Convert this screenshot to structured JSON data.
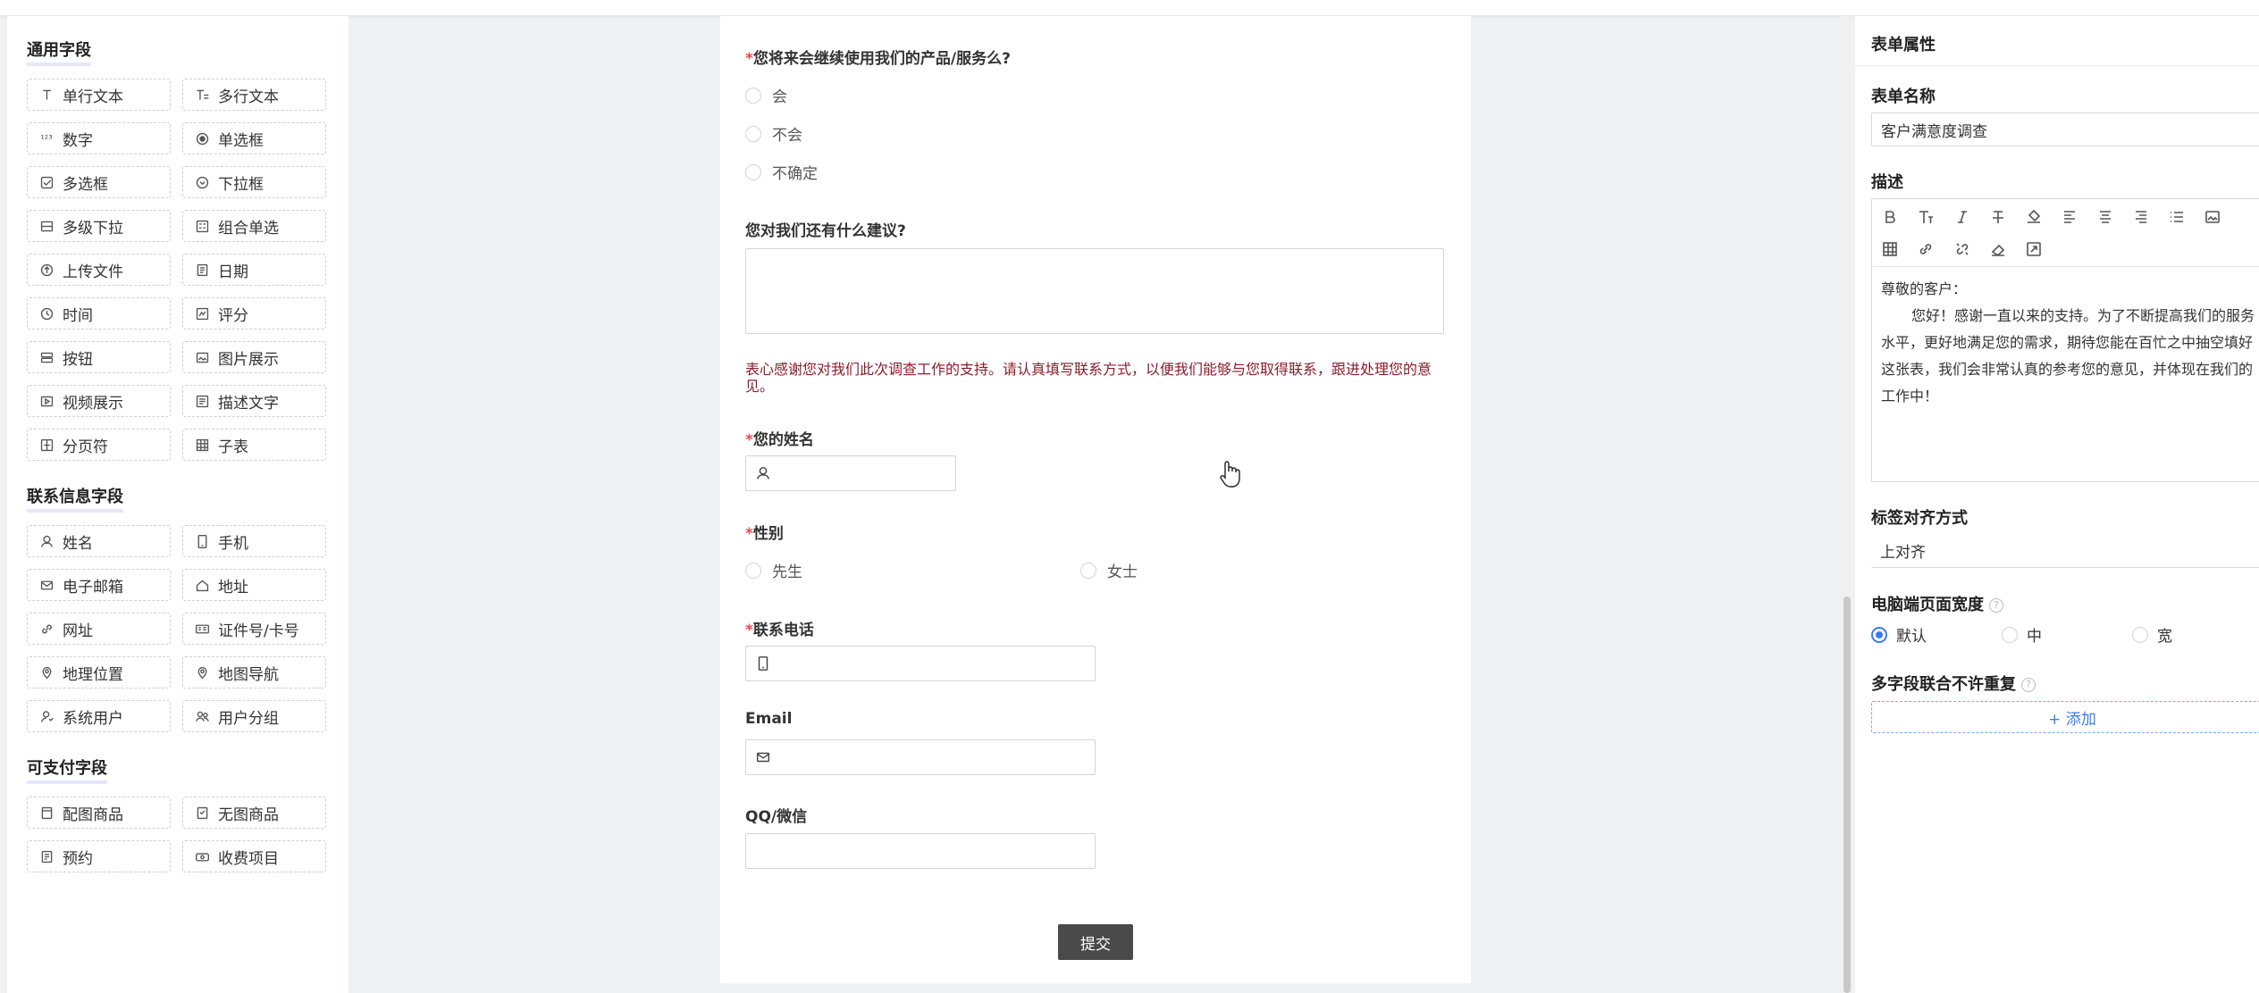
{
  "palette": {
    "sections": [
      {
        "title": "通用字段",
        "fields": [
          "单行文本",
          "多行文本",
          "数字",
          "单选框",
          "多选框",
          "下拉框",
          "多级下拉",
          "组合单选",
          "上传文件",
          "日期",
          "时间",
          "评分",
          "按钮",
          "图片展示",
          "视频展示",
          "描述文字",
          "分页符",
          "子表"
        ],
        "icons": [
          "text-icon",
          "multiline-text-icon",
          "number-icon",
          "radio-icon",
          "checkbox-icon",
          "dropdown-icon",
          "cascade-dropdown-icon",
          "combo-radio-icon",
          "upload-icon",
          "calendar-icon",
          "clock-icon",
          "rating-icon",
          "button-icon",
          "image-icon",
          "video-icon",
          "description-icon",
          "page-break-icon",
          "sub-table-icon"
        ]
      },
      {
        "title": "联系信息字段",
        "fields": [
          "姓名",
          "手机",
          "电子邮箱",
          "地址",
          "网址",
          "证件号/卡号",
          "地理位置",
          "地图导航",
          "系统用户",
          "用户分组"
        ],
        "icons": [
          "user-icon",
          "phone-icon",
          "mail-icon",
          "home-icon",
          "link-icon",
          "id-card-icon",
          "location-icon",
          "map-pin-icon",
          "system-user-icon",
          "user-group-icon"
        ]
      },
      {
        "title": "可支付字段",
        "fields": [
          "配图商品",
          "无图商品",
          "预约",
          "收费项目"
        ],
        "icons": [
          "product-image-icon",
          "product-icon",
          "reservation-icon",
          "fee-icon"
        ]
      }
    ]
  },
  "form": {
    "q1": {
      "required": "*",
      "label": "您将来会继续使用我们的产品/服务么?",
      "options": [
        "会",
        "不会",
        "不确定"
      ]
    },
    "q2": {
      "label": "您对我们还有什么建议?"
    },
    "note": "表心感谢您对我们此次调查工作的支持。请认真填写联系方式，以便我们能够与您取得联系，跟进处理您的意见。",
    "name": {
      "required": "*",
      "label": "您的姓名"
    },
    "gender": {
      "required": "*",
      "label": "性别",
      "options": [
        "先生",
        "女士"
      ]
    },
    "phone": {
      "required": "*",
      "label": "联系电话"
    },
    "email": {
      "label": "Email"
    },
    "qq": {
      "label": "QQ/微信"
    },
    "submit": "提交"
  },
  "props": {
    "header": "表单属性",
    "name_label": "表单名称",
    "name_value": "客户满意度调查",
    "desc_label": "描述",
    "desc_lines": [
      "尊敬的客户：",
      "您好！感谢一直以来的支持。为了不断提高我们的服务水平，更好地满足您的需求，期待您能在百忙之中抽空填好这张表，我们会非常认真的参考您的意见，并体现在我们的工作中！"
    ],
    "align_label": "标签对齐方式",
    "align_value": "上对齐",
    "width_label": "电脑端页面宽度",
    "width_options": [
      "默认",
      "中",
      "宽"
    ],
    "width_selected": "默认",
    "dup_label": "多字段联合不许重复",
    "add_label": "+ 添加",
    "help_mark": "?"
  },
  "colors": {
    "accent": "#3a7bfd",
    "required": "#e5484d",
    "note": "#8c1c2b",
    "submit_bg": "#4a4a4a"
  }
}
